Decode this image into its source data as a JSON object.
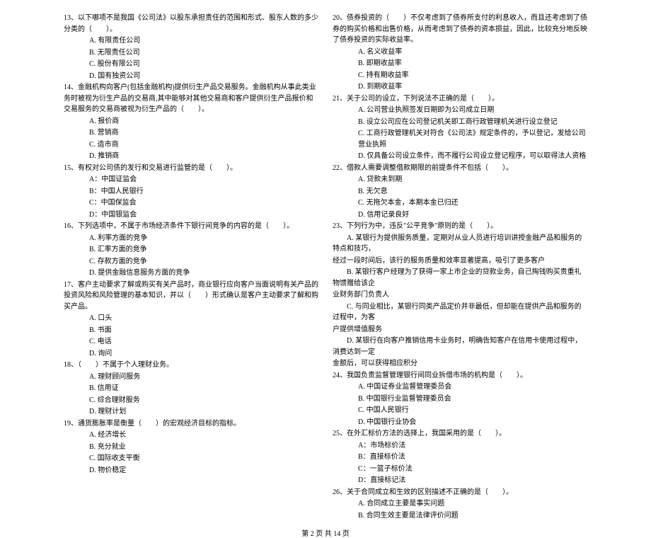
{
  "left": {
    "q13": {
      "stem": "13、以下哪项不是我国《公司法》以股东承担责任的范围和形式、股东人数的多少分类的（　　）。",
      "a": "A. 有限责任公司",
      "b": "B. 无限责任公司",
      "c": "C. 股份有限公司",
      "d": "D. 国有独资公司"
    },
    "q14": {
      "stem": "14、金融机构向客户(包括金融机构)提供衍生产品交易服务。金融机构从事此类业务时被视为衍生产品的交易商,其中能够对其他交易商和客户提供衍生产品报价和交易服务的交易商被视为衍生产品的（　　）。",
      "a": "A. 报价商",
      "b": "B. 营销商",
      "c": "C. 造市商",
      "d": "D. 推销商"
    },
    "q15": {
      "stem": "15、有权对公司债的发行和交易进行监管的是（　　）。",
      "a": "A：中国证监会",
      "b": "B：中国人民银行",
      "c": "C：中国保监会",
      "d": "D：中国银监会"
    },
    "q16": {
      "stem": "16、下列选项中，不属于市场经济条件下银行间竞争的内容的是（　　）。",
      "a": "A. 利率方面的竞争",
      "b": "B. 汇率方面的竞争",
      "c": "C. 存款方面的竞争",
      "d": "D. 提供金融信息服务方面的竞争"
    },
    "q17": {
      "stem": "17、客户主动要求了解或购买有关产品时，商业银行应向客户当面说明有关产品的投资风险和风险管理的基本知识，并以（　　）形式确认是客户主动要求了解和购买产品。",
      "a": "A. 口头",
      "b": "B. 书面",
      "c": "C. 电话",
      "d": "D. 询问"
    },
    "q18": {
      "stem": "18、（　　）不属于个人理财业务。",
      "a": "A. 理财顾问服务",
      "b": "B. 信用证",
      "c": "C. 综合理财服务",
      "d": "D. 理财计划"
    },
    "q19": {
      "stem": "19、通货膨胀率是衡量（　　）的宏观经济目标的指标。",
      "a": "A. 经济增长",
      "b": "B. 充分就业",
      "c": "C. 国际收支平衡",
      "d": "D. 物价稳定"
    }
  },
  "right": {
    "q20": {
      "stem": "20、债券投资的（　　）不仅考虑到了债券所支付的利息收入，而且还考虑到了债券的购买价格和出售价格，从而考虑到了债券的资本损益，因此，比较充分地反映了债券投资的实际收益率。",
      "a": "A. 名义收益率",
      "b": "B. 即期收益率",
      "c": "C. 持有期收益率",
      "d": "D. 到期收益率"
    },
    "q21": {
      "stem": "21、关于公司的设立，下列说法不正确的是（　　）。",
      "a": "A. 公司营业执照签发日期即为公司成立日期",
      "b": "B. 设立公司应在公司登记机关即工商行政管理机关进行设立登记",
      "c": "C. 工商行政管理机关对符合《公司法》规定条件的，予以登记，发给公司营业执照",
      "d": "D. 仅具备公司设立条件，而不履行公司设立登记程序，可以取得法人资格"
    },
    "q22": {
      "stem": "22、借款人需要调整借款期限的前提条件不包括（　　）。",
      "a": "A. 贷款未到期",
      "b": "B. 无欠息",
      "c": "C. 无拖欠本金，本期本金已归还",
      "d": "D. 信用记录良好"
    },
    "q23": {
      "stem": "23、下列行为中，违反\"公平竞争\"原则的是（　　）。",
      "a_line1": "　　A. 某银行为提供服务质量，定期对从业人员进行培训讲授金融产品和服务的特点和技巧，",
      "a_line2": "经过一段时间后，该行的服务质量和效率显著提高，吸引了更多客户",
      "b_line1": "　　B. 某银行客户经理为了获得一家上市企业的贷款业务，自己掏钱购买贵重礼物馈赠给该企",
      "b_line2": "业财务部门负责人",
      "c_line1": "　　C. 与同业相比，某银行同类产品定价并非最低，但却能在提供产品和服务的过程中，为客",
      "c_line2": "户提供增值服务",
      "d_line1": "　　D. 某银行在向客户推销信用卡业务时，明确告知客户在信用卡使用过程中，消费达到一定",
      "d_line2": "金额后，可以获得相应积分"
    },
    "q24": {
      "stem": "24、我国负责监督管理银行间同业拆借市场的机构是（　　）。",
      "a": "A. 中国证券业监督管理委员会",
      "b": "B. 中国银行业监督管理委员会",
      "c": "C. 中国人民银行",
      "d": "D. 中国银行业协会"
    },
    "q25": {
      "stem": "25、在外汇标价方法的选择上，我国采用的是（　　）。",
      "a": "A：市场标价法",
      "b": "B：直接标价法",
      "c": "C：一篮子标价法",
      "d": "D：直接标记法"
    },
    "q26": {
      "stem": "26、关于合同成立和生效的区别描述不正确的是（　　）。",
      "a": "A. 合同成立主要是事实问题",
      "b": "B. 合同生效主要是法律评价问题"
    }
  },
  "footer": "第 2 页 共 14 页"
}
